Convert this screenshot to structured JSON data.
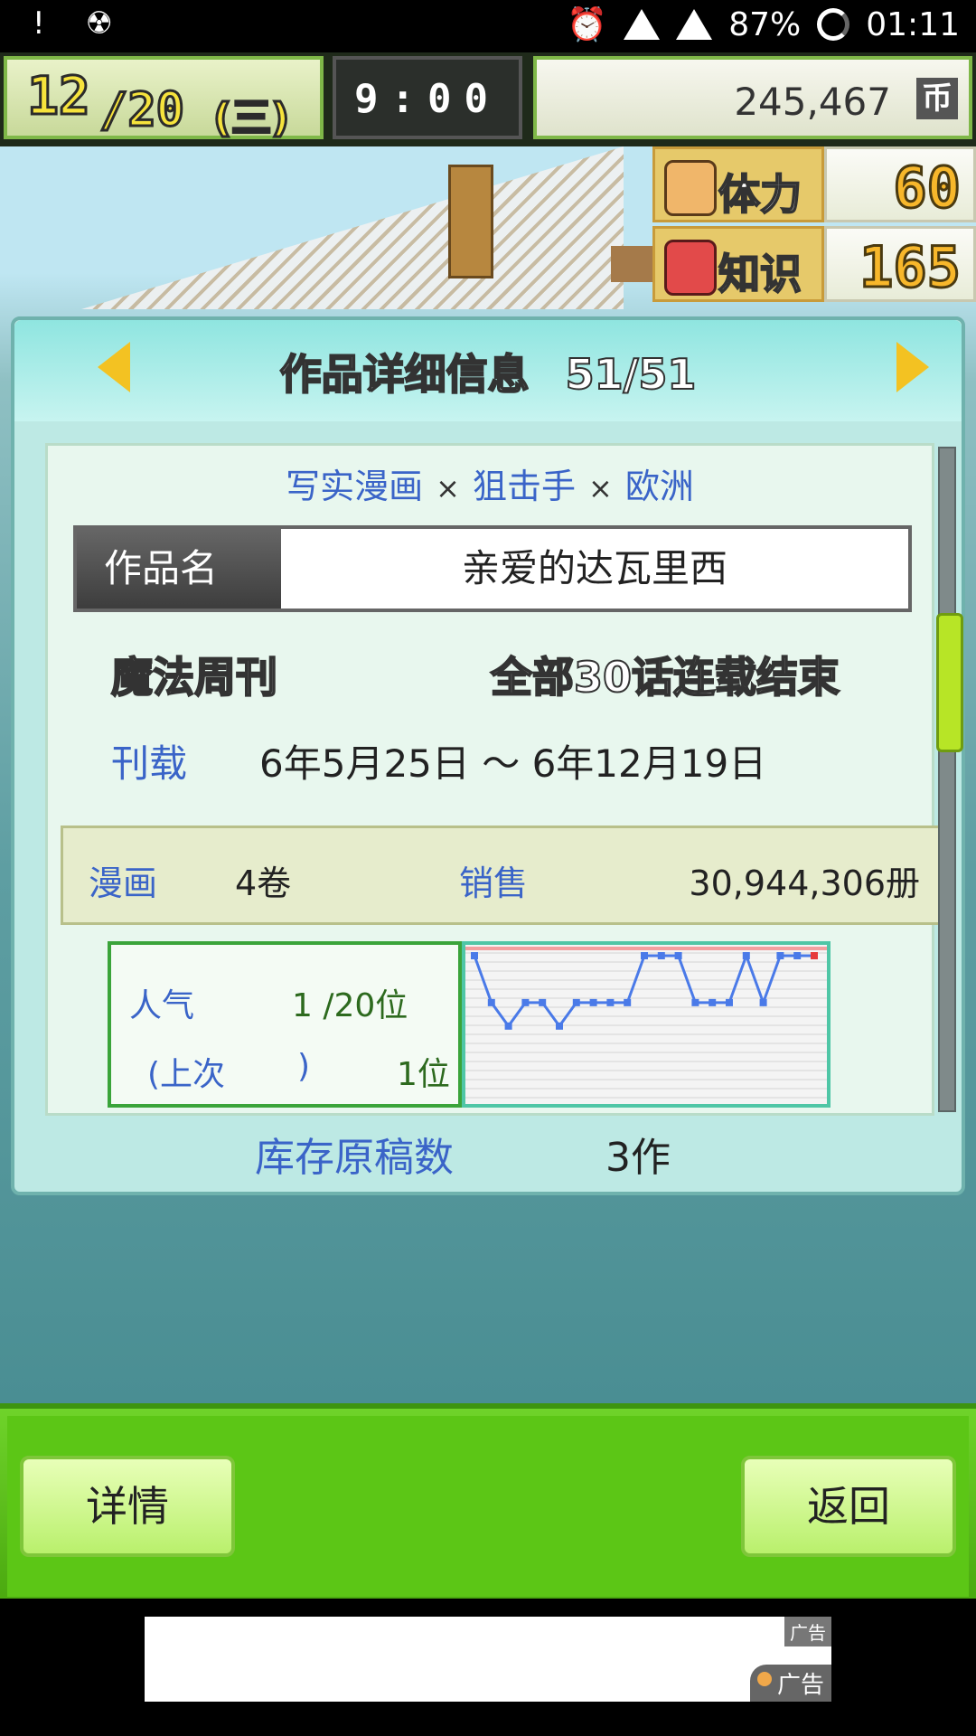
{
  "status_bar": {
    "left_icons": [
      "!",
      "☢"
    ],
    "battery": "87%",
    "time": "01:11"
  },
  "hud": {
    "month": "12",
    "day": "20",
    "weekday": "(三)",
    "clock": "9:00",
    "money": "245,467",
    "money_unit": "币"
  },
  "stats": [
    {
      "label": "体力",
      "value": "60",
      "icon": "muscle-icon",
      "color": "#f0b66a"
    },
    {
      "label": "知识",
      "value": "165",
      "icon": "book-icon",
      "color": "#e24a4a"
    }
  ],
  "dialog": {
    "title": "作品详细信息",
    "count": "51/51",
    "genres": [
      "写实漫画",
      "狙击手",
      "欧洲"
    ],
    "genre_separator": "×",
    "work_name_label": "作品名",
    "work_name": "亲爱的达瓦里西",
    "magazine": "魔法周刊",
    "status": "全部30话连载结束",
    "period_label": "刊载",
    "period": "6年5月25日 ～ 6年12月19日",
    "manga_label": "漫画",
    "volumes": "4卷",
    "sales_label": "销售",
    "sales": "30,944,306册",
    "popularity_label": "人气",
    "popularity": "1 /20位",
    "last_label": "(上次",
    "last_close": ")",
    "last_value": "1位",
    "stock_label": "库存原稿数",
    "stock_value": "3作"
  },
  "chart_data": {
    "type": "line",
    "series": [
      {
        "values": [
          1,
          3,
          4,
          3,
          3,
          4,
          3,
          3,
          3,
          3,
          1,
          1,
          1,
          3,
          3,
          3,
          1,
          3,
          1,
          1,
          1
        ]
      }
    ],
    "ylim": [
      1,
      20
    ],
    "invert_y": true,
    "line_color": "#4a7ae8",
    "current_marker_color": "#e63a3a"
  },
  "buttons": {
    "detail": "详情",
    "back": "返回"
  },
  "ad": {
    "tag1": "广告",
    "tag2": "广告"
  }
}
